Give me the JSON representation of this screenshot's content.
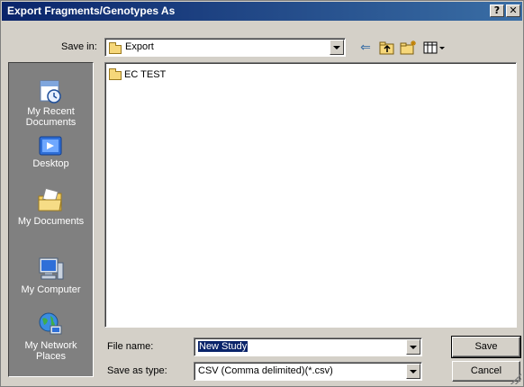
{
  "window": {
    "title": "Export Fragments/Genotypes As",
    "help_label": "?",
    "close_label": "✕"
  },
  "save_in": {
    "label": "Save in:",
    "value": "Export"
  },
  "toolbar": {
    "back_icon": "back-arrow-icon",
    "up_icon": "up-folder-icon",
    "new_folder_icon": "new-folder-icon",
    "views_icon": "views-menu-icon"
  },
  "places": [
    {
      "label": "My Recent Documents",
      "icon": "recent-documents-icon"
    },
    {
      "label": "Desktop",
      "icon": "desktop-icon"
    },
    {
      "label": "My Documents",
      "icon": "my-documents-icon"
    },
    {
      "label": "My Computer",
      "icon": "my-computer-icon"
    },
    {
      "label": "My Network Places",
      "icon": "network-places-icon"
    }
  ],
  "files": [
    {
      "name": "EC TEST",
      "type": "folder"
    }
  ],
  "file_name": {
    "label": "File name:",
    "value": "New Study"
  },
  "save_as_type": {
    "label": "Save as type:",
    "value": "CSV (Comma delimited)(*.csv)"
  },
  "buttons": {
    "save": "Save",
    "cancel": "Cancel"
  }
}
